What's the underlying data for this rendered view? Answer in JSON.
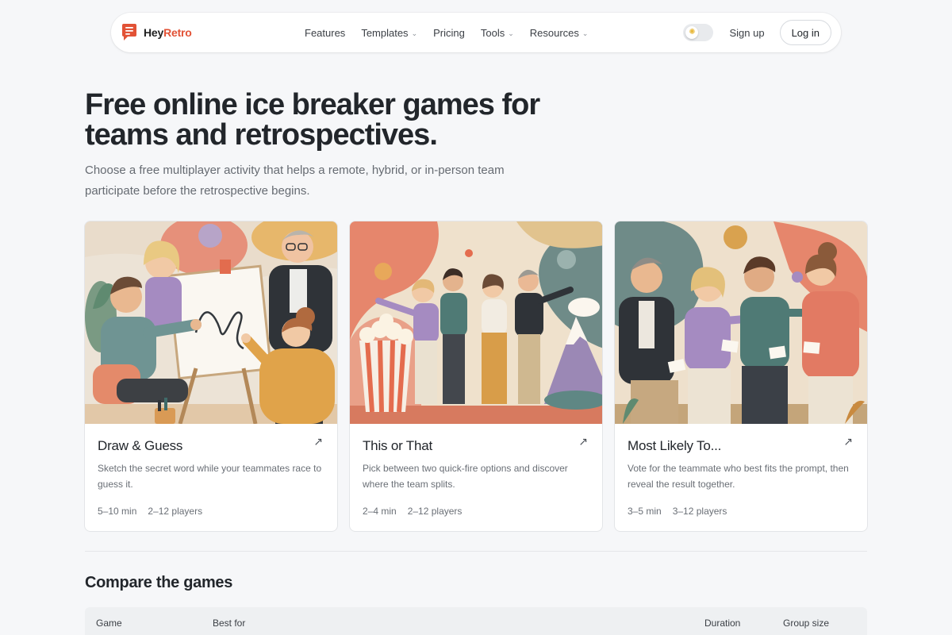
{
  "nav": {
    "logo_hey": "Hey",
    "logo_retro": "Retro",
    "links": [
      {
        "label": "Features",
        "dropdown": false
      },
      {
        "label": "Templates",
        "dropdown": true
      },
      {
        "label": "Pricing",
        "dropdown": false
      },
      {
        "label": "Tools",
        "dropdown": true
      },
      {
        "label": "Resources",
        "dropdown": true
      }
    ],
    "theme_toggle_icon": "sun-icon",
    "signup_label": "Sign up",
    "login_label": "Log in"
  },
  "hero": {
    "title": "Free online ice breaker games for teams and retrospectives.",
    "subtitle": "Choose a free multiplayer activity that helps a remote, hybrid, or in-person team participate before the retrospective begins."
  },
  "cards": [
    {
      "title": "Draw & Guess",
      "description": "Sketch the secret word while your teammates race to guess it.",
      "duration": "5–10 min",
      "players": "2–12 players",
      "arrow_icon": "arrow-up-right-icon"
    },
    {
      "title": "This or That",
      "description": "Pick between two quick-fire options and discover where the team splits.",
      "duration": "2–4 min",
      "players": "2–12 players",
      "arrow_icon": "arrow-up-right-icon"
    },
    {
      "title": "Most Likely To...",
      "description": "Vote for the teammate who best fits the prompt, then reveal the result together.",
      "duration": "3–5 min",
      "players": "3–12 players",
      "arrow_icon": "arrow-up-right-icon"
    }
  ],
  "compare": {
    "title": "Compare the games",
    "columns": [
      "Game",
      "Best for",
      "Duration",
      "Group size"
    ]
  },
  "colors": {
    "brand": "#e25236",
    "background": "#f6f7f9",
    "text": "#22262b"
  }
}
